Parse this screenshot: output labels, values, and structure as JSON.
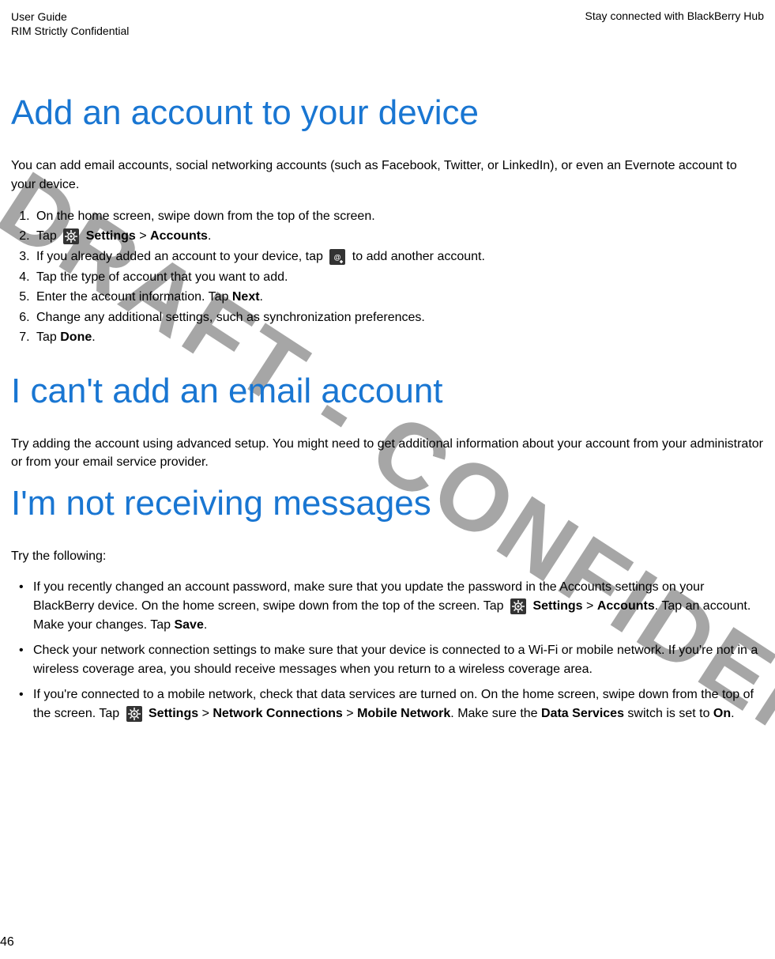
{
  "header": {
    "left_line1": "User Guide",
    "left_line2": "RIM Strictly Confidential",
    "right": "Stay connected with BlackBerry Hub"
  },
  "watermark": "DRAFT - CONFIDENTIAL",
  "section1": {
    "title": "Add an account to your device",
    "intro": "You can add email accounts, social networking accounts (such as Facebook, Twitter, or LinkedIn), or even an Evernote account to your device.",
    "steps": {
      "s1": "On the home screen, swipe down from the top of the screen.",
      "s2_a": "Tap ",
      "s2_b": " Settings",
      "s2_c": " > ",
      "s2_d": "Accounts",
      "s2_e": ".",
      "s3_a": "If you already added an account to your device, tap ",
      "s3_b": " to add another account.",
      "s4": "Tap the type of account that you want to add.",
      "s5_a": "Enter the account information. Tap ",
      "s5_b": "Next",
      "s5_c": ".",
      "s6": "Change any additional settings, such as synchronization preferences.",
      "s7_a": "Tap ",
      "s7_b": "Done",
      "s7_c": "."
    }
  },
  "section2": {
    "title": "I can't add an email account",
    "para": "Try adding the account using advanced setup. You might need to get additional information about your account from your administrator or from your email service provider."
  },
  "section3": {
    "title": "I'm not receiving messages",
    "intro": "Try the following:",
    "b1_a": "If you recently changed an account password, make sure that you update the password in the Accounts settings on your BlackBerry device. On the home screen, swipe down from the top of the screen. Tap ",
    "b1_b": " Settings",
    "b1_c": " > ",
    "b1_d": "Accounts",
    "b1_e": ". Tap an account. Make your changes. Tap ",
    "b1_f": "Save",
    "b1_g": ".",
    "b2": "Check your network connection settings to make sure that your device is connected to a Wi-Fi or mobile network.  If you're not in a wireless coverage area, you should receive messages when you return to a wireless coverage area.",
    "b3_a": "If you're connected to a mobile network, check that data services are turned on. On the home screen, swipe down from the top of the screen. Tap ",
    "b3_b": " Settings",
    "b3_c": " > ",
    "b3_d": "Network Connections",
    "b3_e": " > ",
    "b3_f": "Mobile Network",
    "b3_g": ". Make sure the ",
    "b3_h": "Data Services",
    "b3_i": " switch is set to ",
    "b3_j": "On",
    "b3_k": "."
  },
  "pageNumber": "46"
}
